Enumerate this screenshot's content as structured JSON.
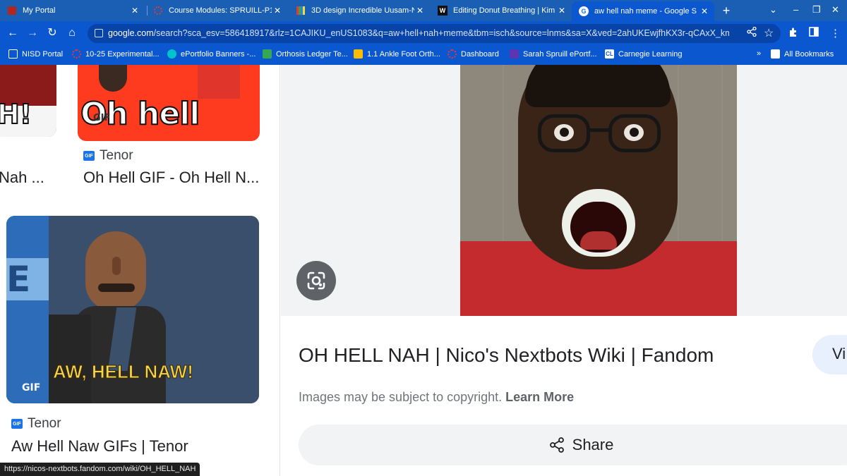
{
  "tabs": [
    {
      "title": "My Portal",
      "favicon": "portal-icon",
      "active": false
    },
    {
      "title": "Course Modules: SPRUILL-P1-",
      "favicon": "canvas-icon",
      "active": false
    },
    {
      "title": "3D design Incredible Uusam-N",
      "favicon": "tinkercad-icon",
      "active": false
    },
    {
      "title": "Editing Donut Breathing | Kim",
      "favicon": "wix-icon",
      "active": false
    },
    {
      "title": "aw hell nah meme - Google S",
      "favicon": "google-icon",
      "active": true
    }
  ],
  "toolbar": {
    "back": "←",
    "forward": "→",
    "reload": "↻",
    "home": "⌂",
    "url_host": "google.com",
    "url_rest": "/search?sca_esv=586418917&rlz=1CAJIKU_enUS1083&q=aw+hell+nah+meme&tbm=isch&source=lnms&sa=X&ved=2ahUKEwjfhKX3r-qCAxX_kmoF...",
    "share_icon": "share-icon",
    "star_icon": "star-icon"
  },
  "bookmarks": [
    {
      "label": "NISD Portal",
      "icon": "folder-icon"
    },
    {
      "label": "10-25 Experimental...",
      "icon": "canvas-icon"
    },
    {
      "label": "ePortfolio Banners -...",
      "icon": "canva-icon"
    },
    {
      "label": "Orthosis Ledger Te...",
      "icon": "sheets-icon"
    },
    {
      "label": "1.1 Ankle Foot Orth...",
      "icon": "slides-icon"
    },
    {
      "label": "Dashboard",
      "icon": "canvas-icon"
    },
    {
      "label": "Sarah Spruill ePortf...",
      "icon": "site-icon"
    },
    {
      "label": "Carnegie Learning",
      "icon": "cl-icon"
    }
  ],
  "bookmarks_more": "»",
  "all_bookmarks": "All Bookmarks",
  "results": {
    "item1": {
      "thumb_text": "Oh hell naw",
      "gif_badge": "GIF",
      "source": "Tenor",
      "title": "Oh Hell GIF - Oh Hell N..."
    },
    "item_partial": {
      "thumb_text": "H!",
      "title": "Nah ..."
    },
    "item2": {
      "thumb_text": "AW, HELL NAW!",
      "gif_badge": "GIF",
      "source": "Tenor",
      "title": "Aw Hell Naw GIFs | Tenor"
    }
  },
  "preview": {
    "title": "OH HELL NAH | Nico's Nextbots Wiki | Fandom",
    "visit": "Vi",
    "copyright": "Images may be subject to copyright.",
    "learn_more": "Learn More",
    "share": "Share"
  },
  "status_url": "https://nicos-nextbots.fandom.com/wiki/OH_HELL_NAH",
  "colors": {
    "chrome": "#0b57d0",
    "tabstrip": "#1a5fb4",
    "accent": "#1a73e8"
  }
}
